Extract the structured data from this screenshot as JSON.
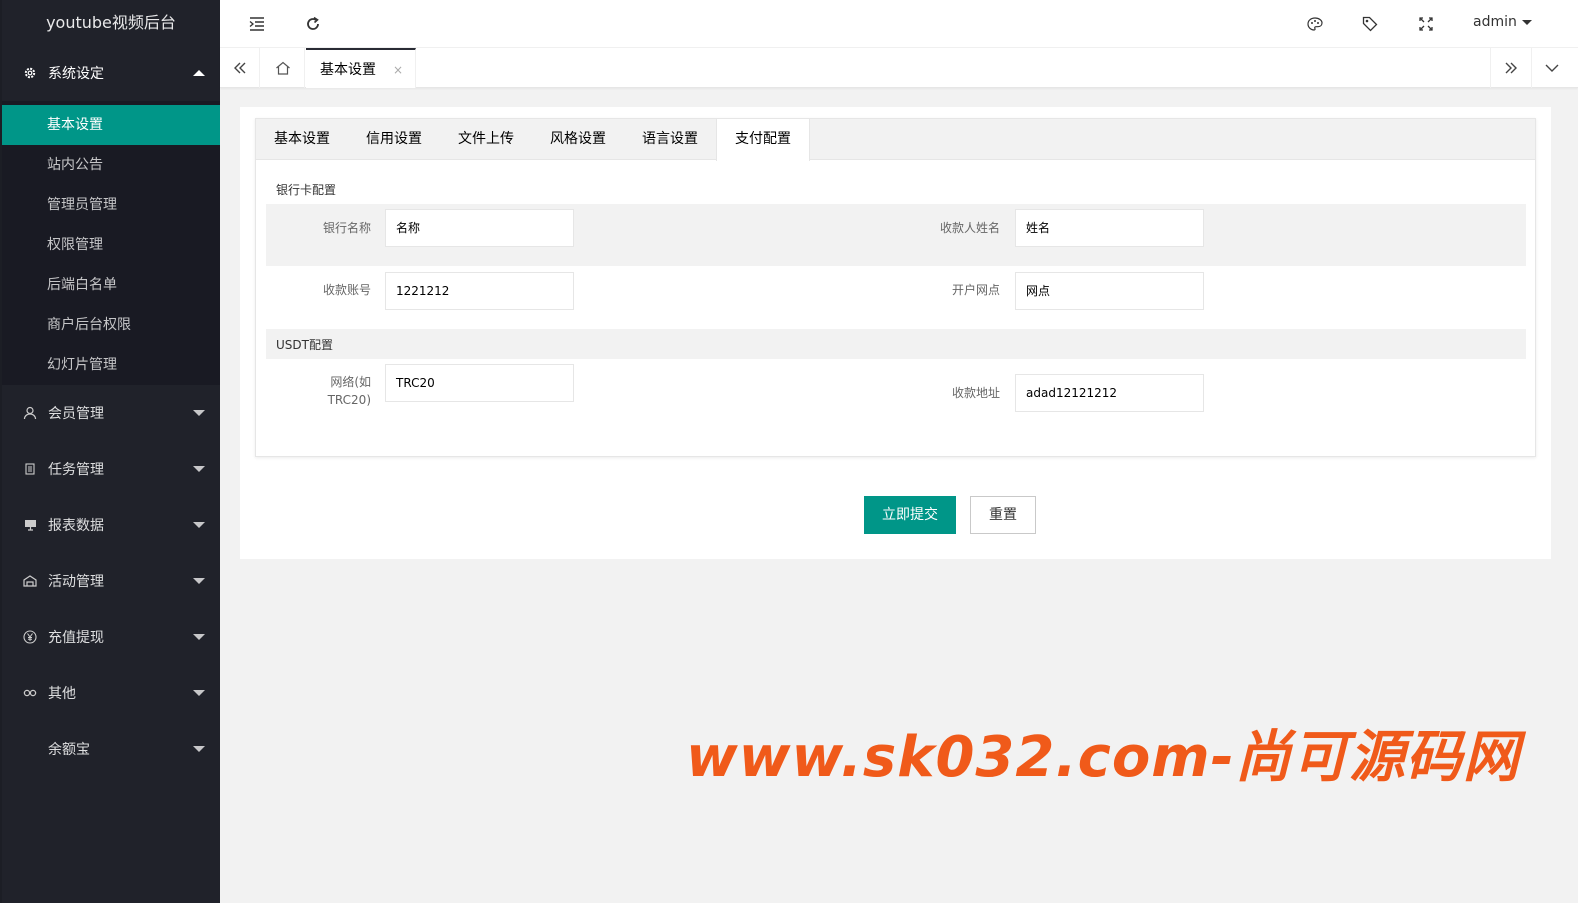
{
  "app": {
    "title": "youtube视频后台",
    "user": "admin"
  },
  "sidebar": {
    "groups": [
      {
        "label": "系统设定",
        "icon": "gear-icon",
        "open": true,
        "items": [
          {
            "label": "基本设置",
            "active": true
          },
          {
            "label": "站内公告"
          },
          {
            "label": "管理员管理"
          },
          {
            "label": "权限管理"
          },
          {
            "label": "后端白名单"
          },
          {
            "label": "商户后台权限"
          },
          {
            "label": "幻灯片管理"
          }
        ]
      },
      {
        "label": "会员管理",
        "icon": "user-icon"
      },
      {
        "label": "任务管理",
        "icon": "file-icon"
      },
      {
        "label": "报表数据",
        "icon": "monitor-icon"
      },
      {
        "label": "活动管理",
        "icon": "app-icon"
      },
      {
        "label": "充值提现",
        "icon": "yen-icon"
      },
      {
        "label": "其他",
        "icon": "link-icon"
      },
      {
        "label": "余额宝",
        "icon": ""
      }
    ]
  },
  "tabsbar": {
    "current_tab": "基本设置",
    "close": "×"
  },
  "settings": {
    "tabs": [
      "基本设置",
      "信用设置",
      "文件上传",
      "风格设置",
      "语言设置",
      "支付配置"
    ],
    "active_tab": 5,
    "bank": {
      "section": "银行卡配置",
      "bank_name_label": "银行名称",
      "bank_name_value": "名称",
      "payee_label": "收款人姓名",
      "payee_value": "姓名",
      "account_label": "收款账号",
      "account_value": "1221212",
      "branch_label": "开户网点",
      "branch_value": "网点"
    },
    "usdt": {
      "section": "USDT配置",
      "network_label": "网络(如TRC20)",
      "network_value": "TRC20",
      "address_label": "收款地址",
      "address_value": "adad12121212"
    },
    "submit_label": "立即提交",
    "reset_label": "重置"
  },
  "watermark": "www.sk032.com-尚可源码网"
}
